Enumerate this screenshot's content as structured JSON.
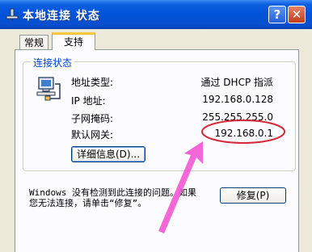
{
  "window": {
    "title": "本地连接 状态",
    "help_label": "?",
    "close_label": "✕"
  },
  "tabs": [
    {
      "label": "常规"
    },
    {
      "label": "支持"
    }
  ],
  "connection_status": {
    "group_label": "连接状态",
    "rows": [
      {
        "label": "地址类型:",
        "value": "通过 DHCP 指派"
      },
      {
        "label": "IP 地址:",
        "value": "192.168.0.128"
      },
      {
        "label": "子网掩码:",
        "value": "255.255.255.0"
      },
      {
        "label": "默认网关:",
        "value": "192.168.0.1"
      }
    ],
    "details_button": "详细信息(D)..."
  },
  "repair": {
    "message_line1": "Windows 没有检测到此连接的问题。如果",
    "message_line2": "您无法连接，请单击“修复”。",
    "button_label": "修复(P)"
  },
  "colors": {
    "annotation_ellipse": "#d42a3a",
    "annotation_arrow": "#f25bd2"
  }
}
